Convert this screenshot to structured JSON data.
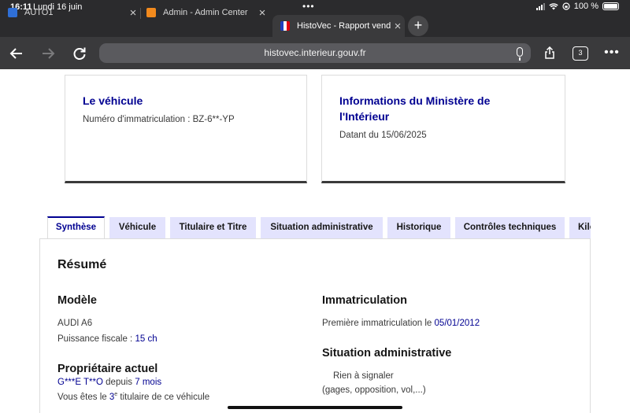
{
  "status": {
    "time": "16:11",
    "date": "Lundi 16 juin",
    "dots": "•••",
    "battery": "100 %"
  },
  "tabs": [
    {
      "title": "AUTO1",
      "active": false
    },
    {
      "title": "Admin - Admin Center",
      "active": false
    },
    {
      "title": "HistoVec - Rapport vendeur",
      "active": true
    }
  ],
  "toolbar": {
    "url": "histovec.interieur.gouv.fr",
    "tab_count": "3",
    "new_tab": "+"
  },
  "vehicle_card": {
    "title": "Le véhicule",
    "plate_label": "Numéro d'immatriculation :",
    "plate_value": "BZ-6**-YP"
  },
  "ministry_card": {
    "title_line1": "Informations du Ministère de",
    "title_line2": "l'Intérieur",
    "date_text": "Datant du 15/06/2025"
  },
  "page_tabs": [
    "Synthèse",
    "Véhicule",
    "Titulaire et Titre",
    "Situation administrative",
    "Historique",
    "Contrôles techniques",
    "Kilométrage"
  ],
  "summary": {
    "heading": "Résumé",
    "model_heading": "Modèle",
    "model_value": "AUDI A6",
    "power_label": "Puissance fiscale :",
    "power_value": "15 ch",
    "owner_heading": "Propriétaire actuel",
    "owner_name": "G***E T**O",
    "owner_since_label": "depuis",
    "owner_since_value": "7 mois",
    "owner_rank_prefix": "Vous êtes le",
    "owner_rank_number": "3",
    "owner_rank_sup": "e",
    "owner_rank_suffix": "titulaire de ce véhicule",
    "registration_heading": "Immatriculation",
    "first_registration_label": "Première immatriculation le",
    "first_registration_date": "05/01/2012",
    "admin_heading": "Situation administrative",
    "admin_status": "Rien à signaler",
    "admin_detail": "(gages, opposition, vol,...)"
  },
  "colors": {
    "primary": "#000091",
    "tab_bg": "#e3e3fd",
    "chrome": "#2b2b2d",
    "toolbar": "#3a3a3c"
  }
}
